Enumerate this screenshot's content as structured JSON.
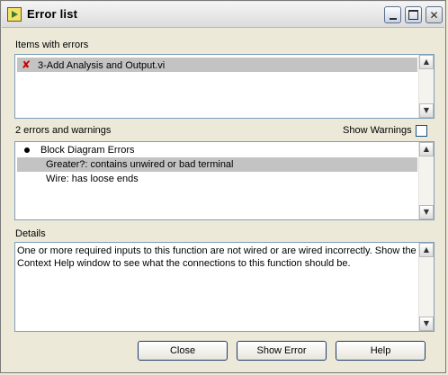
{
  "window": {
    "title": "Error list"
  },
  "items_with_errors": {
    "label": "Items with errors",
    "items": [
      {
        "text": "3-Add Analysis and Output.vi",
        "icon": "error-x-icon",
        "selected": true
      }
    ]
  },
  "errors": {
    "summary": "2 errors and warnings",
    "show_warnings_label": "Show Warnings",
    "show_warnings_checked": false,
    "group": "Block Diagram Errors",
    "items": [
      {
        "text": "Greater?: contains unwired or bad terminal",
        "selected": true
      },
      {
        "text": "Wire: has loose ends",
        "selected": false
      }
    ]
  },
  "details": {
    "label": "Details",
    "text": "One or more required inputs to this function are not wired or are wired incorrectly. Show the Context Help window to see what the connections to this function should be."
  },
  "buttons": {
    "close": "Close",
    "show_error": "Show Error",
    "help": "Help"
  }
}
